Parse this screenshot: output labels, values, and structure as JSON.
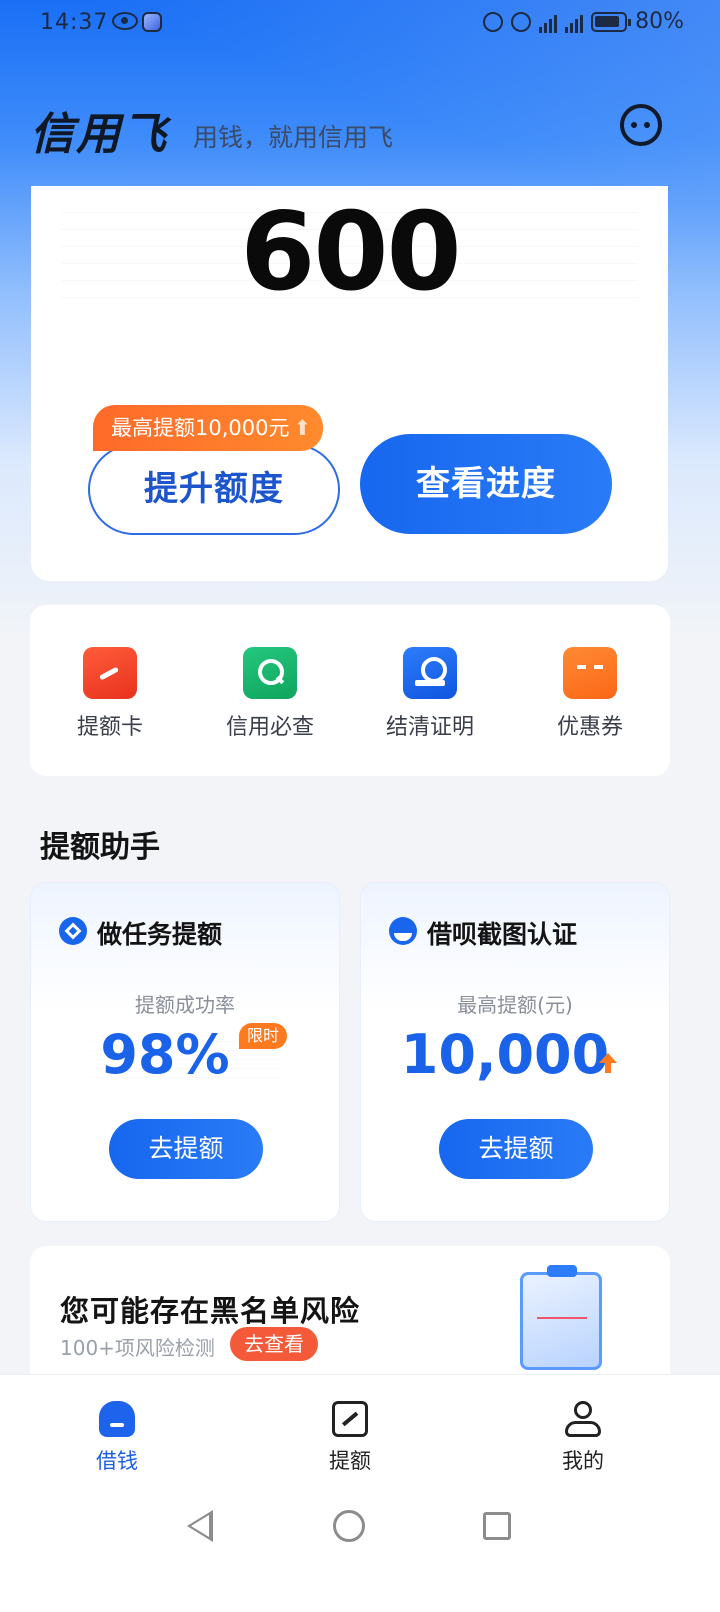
{
  "status_bar": {
    "time": "14:37",
    "battery": "80%",
    "net1": "4G",
    "net2": "5G"
  },
  "header": {
    "app_name": "信用飞",
    "slogan": "用钱，就用信用飞",
    "chat_icon": "chat-bubble-icon"
  },
  "credit_card": {
    "amount": "600",
    "raise_tag": "最高提额10,000元",
    "raise_button": "提升额度",
    "progress_button": "查看进度"
  },
  "quick_actions": [
    {
      "label": "提额卡",
      "icon": "card-icon",
      "color": "#f24a2a"
    },
    {
      "label": "信用必查",
      "icon": "search-icon",
      "color": "#17b86c"
    },
    {
      "label": "结清证明",
      "icon": "stamp-icon",
      "color": "#1d63ec"
    },
    {
      "label": "优惠券",
      "icon": "coupon-icon",
      "color": "#fb6f1c"
    }
  ],
  "helper": {
    "title": "提额助手",
    "cards": [
      {
        "title": "做任务提额",
        "subtitle": "提额成功率",
        "value": "98%",
        "badge": "限时",
        "button": "去提额"
      },
      {
        "title": "借呗截图认证",
        "subtitle": "最高提额(元)",
        "value": "10,000",
        "button": "去提额"
      }
    ]
  },
  "risk": {
    "title": "您可能存在黑名单风险",
    "subtitle": "100+项风险检测",
    "button": "去查看"
  },
  "tabs": [
    {
      "label": "借钱",
      "active": true,
      "icon": "home-icon"
    },
    {
      "label": "提额",
      "active": false,
      "icon": "raise-icon"
    },
    {
      "label": "我的",
      "active": false,
      "icon": "profile-icon"
    }
  ],
  "colors": {
    "primary": "#1767ef",
    "accent_orange": "#ff7a1e",
    "risk_red": "#f45a3a"
  }
}
